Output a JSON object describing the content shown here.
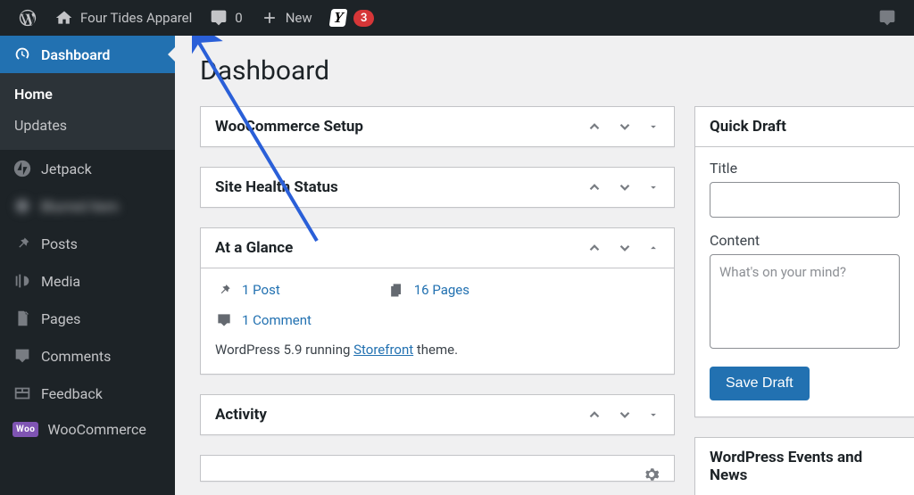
{
  "adminbar": {
    "site_name": "Four Tides Apparel",
    "comments_count": "0",
    "new_label": "New",
    "yoast_notifications": "3"
  },
  "sidebar": {
    "dashboard": "Dashboard",
    "home": "Home",
    "updates": "Updates",
    "jetpack": "Jetpack",
    "blurred": "Blurred Item",
    "posts": "Posts",
    "media": "Media",
    "pages": "Pages",
    "comments": "Comments",
    "feedback": "Feedback",
    "woocommerce": "WooCommerce"
  },
  "page": {
    "title": "Dashboard"
  },
  "postboxes": {
    "woo_setup": "WooCommerce Setup",
    "site_health": "Site Health Status",
    "at_a_glance": "At a Glance",
    "activity": "Activity",
    "events": "WordPress Events and News"
  },
  "glance": {
    "posts": "1 Post",
    "pages": "16 Pages",
    "comments": "1 Comment",
    "wp_version_prefix": "WordPress 5.9 running ",
    "theme": "Storefront",
    "theme_suffix": " theme."
  },
  "quick_draft": {
    "heading": "Quick Draft",
    "title_label": "Title",
    "content_label": "Content",
    "content_placeholder": "What's on your mind?",
    "save_label": "Save Draft"
  }
}
